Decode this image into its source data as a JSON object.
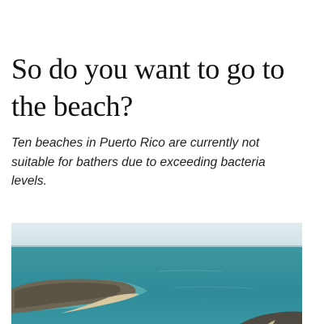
{
  "article": {
    "headline": "So do you want to go to the beach?",
    "subheadline": "Ten beaches in Puerto Rico are currently not suitable for bathers due to exceeding bacteria levels."
  },
  "colors": {
    "text": "#111111",
    "sky": "#d6e6ea",
    "sea": "#2e8f9c"
  },
  "media": {
    "hero_image": "aerial-coastline-photo"
  }
}
